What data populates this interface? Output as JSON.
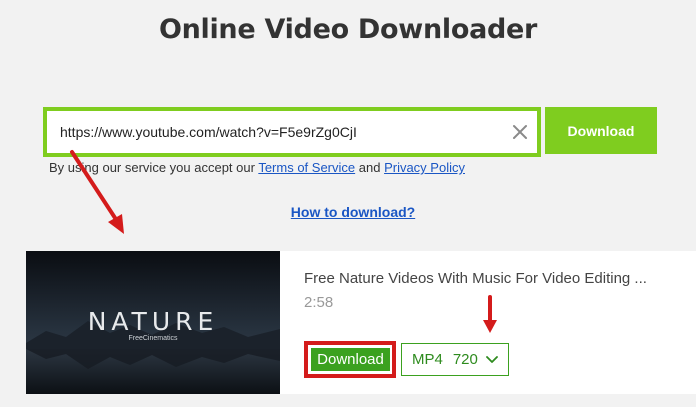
{
  "page": {
    "title": "Online Video Downloader"
  },
  "search": {
    "value": "https://www.youtube.com/watch?v=F5e9rZg0CjI",
    "clear_icon": "close-icon",
    "download_label": "Download"
  },
  "terms": {
    "prefix": "By using our service you accept our ",
    "terms_link": "Terms of Service",
    "middle": " and ",
    "privacy_link": "Privacy Policy"
  },
  "help": {
    "how_to": "How to download?"
  },
  "result": {
    "thumbnail_title": "NATURE",
    "thumbnail_subtitle": "FreeCinematics",
    "video_title": "Free Nature Videos With Music For Video Editing ...",
    "duration": "2:58",
    "download_label": "Download",
    "format": "MP4",
    "resolution": "720",
    "chevron_icon": "chevron-down-icon"
  },
  "colors": {
    "accent_green": "#7fcd1f",
    "button_green": "#3ba11f",
    "link_blue": "#1a56c4",
    "annotation_red": "#d41b1b"
  }
}
